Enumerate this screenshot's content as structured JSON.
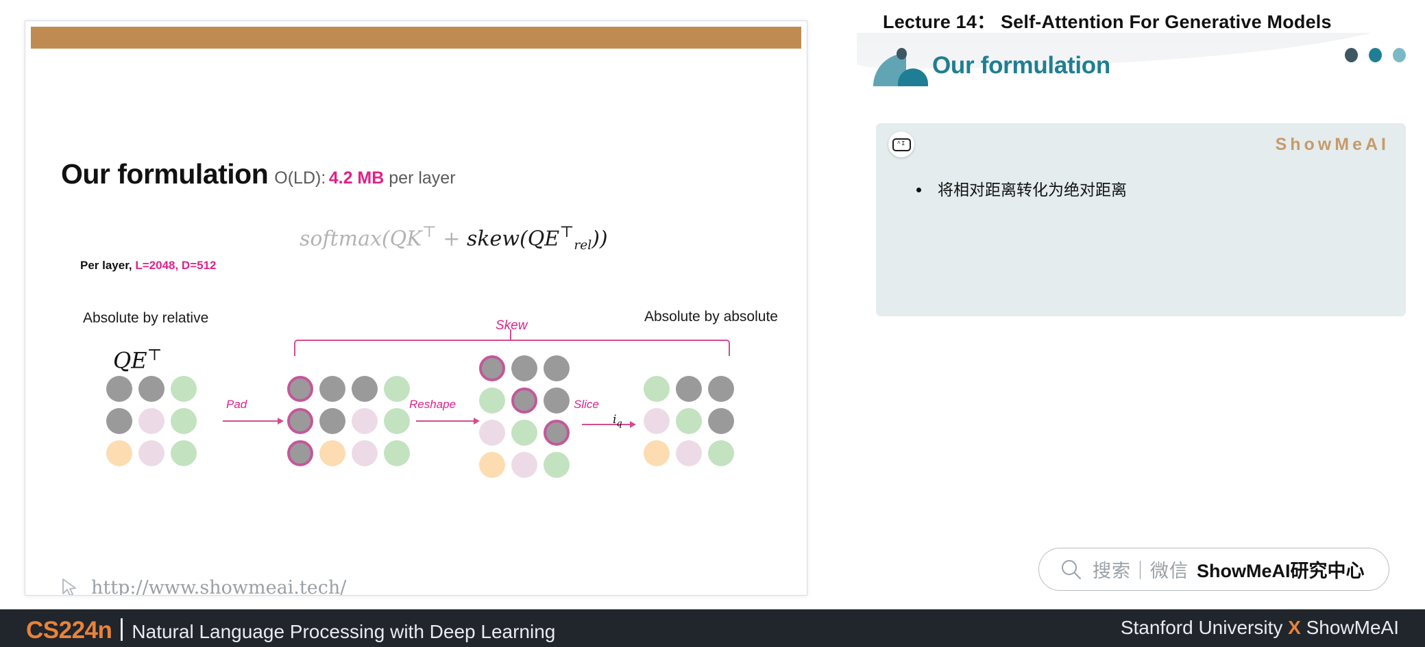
{
  "slide": {
    "title_main": "Our formulation",
    "title_complexity": "O(LD):",
    "title_size": "4.2 MB",
    "title_tail": " per layer",
    "formula_prefix": "softmax(QK",
    "formula_mid": " + ",
    "formula_skew": "skew(QE",
    "formula_sub": "rel",
    "formula_close": "))",
    "per_layer_prefix": "Per layer, ",
    "per_layer_dims": "L=2048, D=512",
    "label_absolute_by_relative": "Absolute by relative",
    "label_absolute_by_absolute": "Absolute by absolute",
    "qe_label": "QE",
    "skew_label": "Skew",
    "arrows": [
      {
        "label": "Pad"
      },
      {
        "label": "Reshape"
      },
      {
        "label": "Slice"
      }
    ],
    "slice_index": "i",
    "slice_index_sub": "q",
    "watermark_url": "http://www.showmeai.tech/",
    "topbar_color": "#c08b52",
    "accent_pink": "#e0218a",
    "grids": [
      {
        "name": "qe-transpose-grid",
        "cols": 3,
        "cells": [
          "gray",
          "gray",
          "green",
          "gray",
          "pink",
          "green",
          "orange",
          "pink",
          "green"
        ],
        "rings": [
          false,
          false,
          false,
          false,
          false,
          false,
          false,
          false,
          false
        ]
      },
      {
        "name": "padded-grid",
        "cols": 4,
        "cells": [
          "gray",
          "gray",
          "gray",
          "green",
          "gray",
          "gray",
          "pink",
          "green",
          "gray",
          "orange",
          "pink",
          "green"
        ],
        "rings": [
          true,
          false,
          false,
          false,
          true,
          false,
          false,
          false,
          true,
          false,
          false,
          false
        ]
      },
      {
        "name": "reshaped-grid",
        "cols": 3,
        "cells": [
          "gray",
          "gray",
          "gray",
          "green",
          "gray",
          "gray",
          "pink",
          "green",
          "gray",
          "orange",
          "pink",
          "green"
        ],
        "rings": [
          true,
          false,
          false,
          false,
          true,
          false,
          false,
          false,
          true,
          false,
          false,
          false
        ]
      },
      {
        "name": "sliced-grid",
        "cols": 3,
        "cells": [
          "green",
          "gray",
          "gray",
          "pink",
          "green",
          "gray",
          "orange",
          "pink",
          "green"
        ],
        "rings": [
          false,
          false,
          false,
          false,
          false,
          false,
          false,
          false,
          false
        ]
      }
    ]
  },
  "right_panel": {
    "lecture_title": "Lecture 14： Self-Attention For Generative Models",
    "section_title": "Our formulation",
    "watermark_brand": "ShowMeAI",
    "ai_badge_text": "^I",
    "bullets": [
      "将相对距离转化为绝对距离"
    ],
    "search": {
      "placeholder_cn": "搜索｜微信",
      "brand": "ShowMeAI研究中心"
    },
    "accent_teal": "#1f7e93",
    "accent_gold": "#c79a6a"
  },
  "footer": {
    "course_code": "CS224n",
    "course_name": "Natural Language Processing with Deep Learning",
    "right_prefix": "Stanford University ",
    "right_x": "X",
    "right_suffix": " ShowMeAI",
    "bg": "#21252c",
    "accent": "#e8833a"
  }
}
